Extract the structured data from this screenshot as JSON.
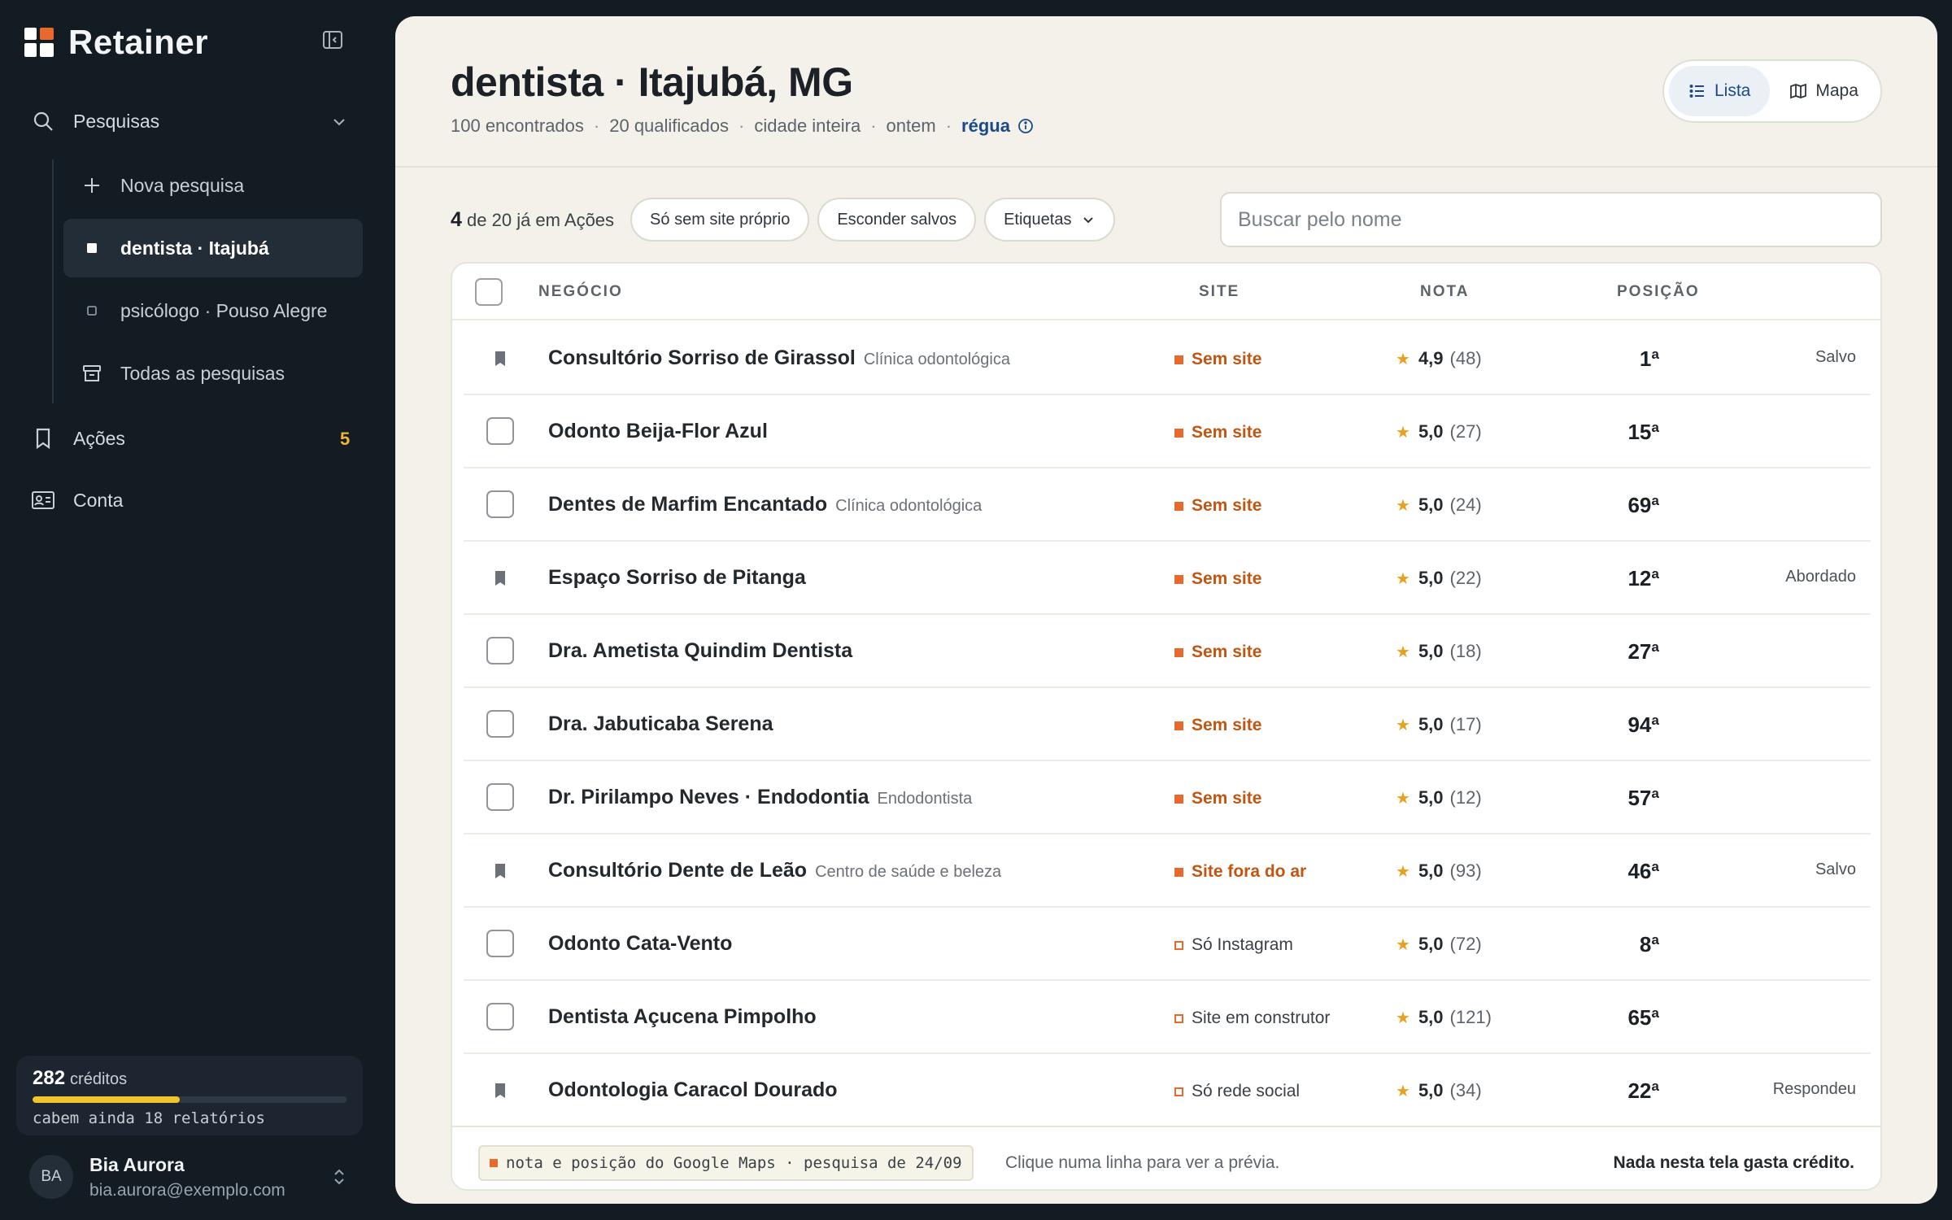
{
  "app": {
    "name": "Retainer"
  },
  "sidebar": {
    "search_section": "Pesquisas",
    "new_search": "Nova pesquisa",
    "searches": [
      {
        "label": "dentista · Itajubá",
        "active": true
      },
      {
        "label": "psicólogo · Pouso Alegre",
        "active": false
      }
    ],
    "all_searches": "Todas as pesquisas",
    "actions": "Ações",
    "actions_count": "5",
    "account": "Conta"
  },
  "credits": {
    "value": "282",
    "label": "créditos",
    "note": "cabem ainda 18 relatórios",
    "fraction": 0.47
  },
  "user": {
    "initials": "BA",
    "name": "Bia Aurora",
    "email": "bia.aurora@exemplo.com"
  },
  "header": {
    "title": "dentista · Itajubá, MG",
    "found": "100 encontrados",
    "qualified": "20 qualificados",
    "scope": "cidade inteira",
    "when": "ontem",
    "link": "régua"
  },
  "view_toggle": {
    "list": "Lista",
    "map": "Mapa",
    "selected": "list"
  },
  "filters": {
    "count_num": "4",
    "count_rest": "de 20 já em Ações",
    "only_no_site": "Só sem site próprio",
    "hide_saved": "Esconder salvos",
    "tags": "Etiquetas",
    "search_placeholder": "Buscar pelo nome"
  },
  "table": {
    "columns": {
      "business": "NEGÓCIO",
      "site": "SITE",
      "rating": "NOTA",
      "position": "POSIÇÃO"
    },
    "rows": [
      {
        "name": "Consultório Sorriso de Girassol",
        "category": "Clínica odontológica",
        "site": "Sem site",
        "site_kind": "bad",
        "rating": "4,9",
        "reviews": "(48)",
        "position": "1ª",
        "status": "Salvo",
        "saved": true
      },
      {
        "name": "Odonto Beija-Flor Azul",
        "category": "",
        "site": "Sem site",
        "site_kind": "bad",
        "rating": "5,0",
        "reviews": "(27)",
        "position": "15ª",
        "status": "",
        "saved": false
      },
      {
        "name": "Dentes de Marfim Encantado",
        "category": "Clínica odontológica",
        "site": "Sem site",
        "site_kind": "bad",
        "rating": "5,0",
        "reviews": "(24)",
        "position": "69ª",
        "status": "",
        "saved": false
      },
      {
        "name": "Espaço Sorriso de Pitanga",
        "category": "",
        "site": "Sem site",
        "site_kind": "bad",
        "rating": "5,0",
        "reviews": "(22)",
        "position": "12ª",
        "status": "Abordado",
        "saved": true
      },
      {
        "name": "Dra. Ametista Quindim Dentista",
        "category": "",
        "site": "Sem site",
        "site_kind": "bad",
        "rating": "5,0",
        "reviews": "(18)",
        "position": "27ª",
        "status": "",
        "saved": false
      },
      {
        "name": "Dra. Jabuticaba Serena",
        "category": "",
        "site": "Sem site",
        "site_kind": "bad",
        "rating": "5,0",
        "reviews": "(17)",
        "position": "94ª",
        "status": "",
        "saved": false
      },
      {
        "name": "Dr. Pirilampo Neves · Endodontia",
        "category": "Endodontista",
        "site": "Sem site",
        "site_kind": "bad",
        "rating": "5,0",
        "reviews": "(12)",
        "position": "57ª",
        "status": "",
        "saved": false
      },
      {
        "name": "Consultório Dente de Leão",
        "category": "Centro de saúde e beleza",
        "site": "Site fora do ar",
        "site_kind": "bad",
        "rating": "5,0",
        "reviews": "(93)",
        "position": "46ª",
        "status": "Salvo",
        "saved": true
      },
      {
        "name": "Odonto Cata-Vento",
        "category": "",
        "site": "Só Instagram",
        "site_kind": "mid",
        "rating": "5,0",
        "reviews": "(72)",
        "position": "8ª",
        "status": "",
        "saved": false
      },
      {
        "name": "Dentista Açucena Pimpolho",
        "category": "",
        "site": "Site em construtor",
        "site_kind": "mid",
        "rating": "5,0",
        "reviews": "(121)",
        "position": "65ª",
        "status": "",
        "saved": false
      },
      {
        "name": "Odontologia Caracol Dourado",
        "category": "",
        "site": "Só rede social",
        "site_kind": "mid",
        "rating": "5,0",
        "reviews": "(34)",
        "position": "22ª",
        "status": "Respondeu",
        "saved": true
      }
    ]
  },
  "footer": {
    "source_note": "nota e posição do Google Maps · pesquisa de 24/09",
    "hint": "Clique numa linha para ver a prévia.",
    "no_cost": "Nada nesta tela gasta crédito."
  },
  "colors": {
    "accent": "#e8692c",
    "link": "#1a4a8a",
    "credit_bar": "#f0c52c",
    "star": "#e7a11f"
  }
}
